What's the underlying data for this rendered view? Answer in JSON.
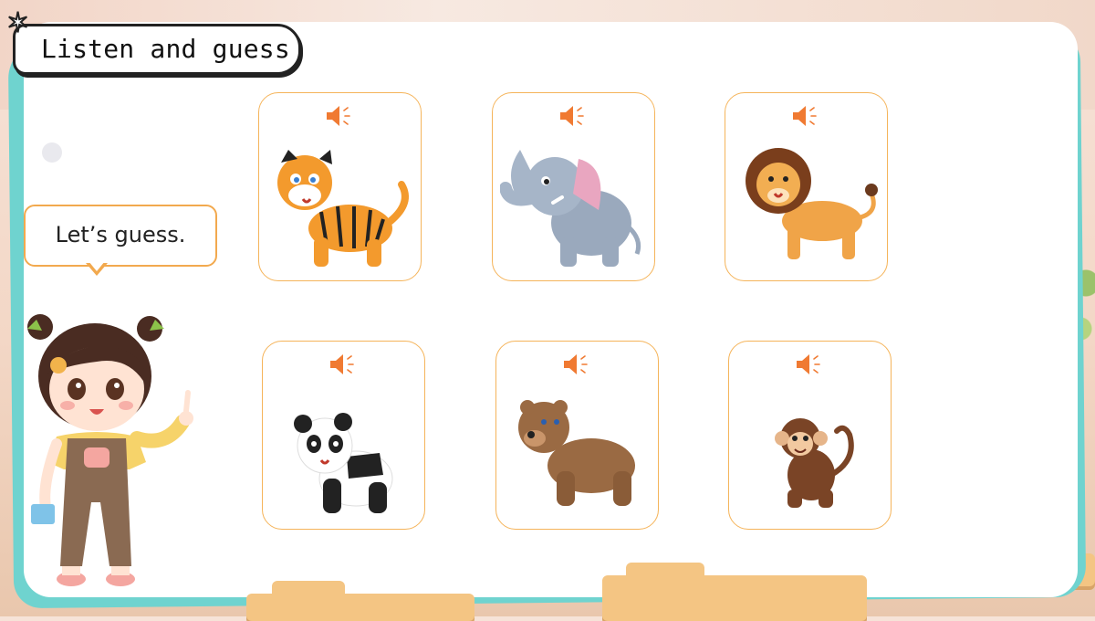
{
  "title": "Listen and guess",
  "bubble_text": "Let’s guess.",
  "colors": {
    "accent_orange": "#f07a32",
    "card_border": "#f5b45a",
    "panel_bg": "#ffffff",
    "teal": "#6fd3cf"
  },
  "cards": [
    {
      "animal": "tiger",
      "icon": "speaker-icon"
    },
    {
      "animal": "elephant",
      "icon": "speaker-icon"
    },
    {
      "animal": "lion",
      "icon": "speaker-icon"
    },
    {
      "animal": "panda",
      "icon": "speaker-icon"
    },
    {
      "animal": "bear",
      "icon": "speaker-icon"
    },
    {
      "animal": "monkey",
      "icon": "speaker-icon"
    }
  ]
}
